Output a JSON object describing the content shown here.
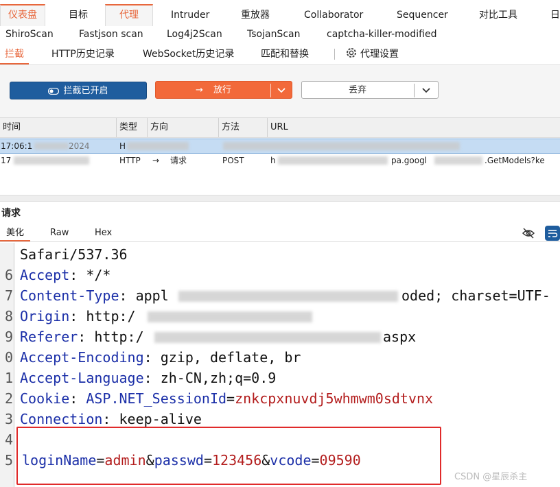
{
  "main_tabs": [
    "仪表盘",
    "目标",
    "代理",
    "Intruder",
    "重放器",
    "Collaborator",
    "Sequencer",
    "对比工具",
    "日"
  ],
  "ext_tabs": [
    "ShiroScan",
    "Fastjson scan",
    "Log4j2Scan",
    "TsojanScan",
    "captcha-killer-modified"
  ],
  "proxy_tabs": [
    "拦截",
    "HTTP历史记录",
    "WebSocket历史记录",
    "匹配和替换",
    "代理设置"
  ],
  "toolbar": {
    "intercept_label": "拦截已开启",
    "forward_label": "放行",
    "drop_label": "丢弃"
  },
  "table": {
    "columns": [
      "时间",
      "类型",
      "方向",
      "方法",
      "URL"
    ],
    "rows": [
      {
        "time": "17:06:1",
        "time_tail": "2024",
        "type": "H",
        "direction": "",
        "method": "",
        "url": ""
      },
      {
        "time": "17",
        "time_tail": "",
        "type": "HTTP",
        "direction": "请求",
        "method": "POST",
        "url_prefix": "h",
        "url": "pa.googl",
        "url_end": ".GetModels?ke"
      }
    ]
  },
  "request": {
    "title": "请求",
    "view_tabs": [
      "美化",
      "Raw",
      "Hex"
    ],
    "lines": [
      {
        "num": "",
        "value": "Safari/537.36"
      },
      {
        "num": "6",
        "key": "Accept",
        "value": "*/*"
      },
      {
        "num": "7",
        "key": "Content-Type",
        "value_a": "appl",
        "value_b": "oded; charset=UTF-"
      },
      {
        "num": "8",
        "key": "Origin",
        "value": "http:/"
      },
      {
        "num": "9",
        "key": "Referer",
        "value": "http:/",
        "value_end": "aspx"
      },
      {
        "num": "0",
        "key": "Accept-Encoding",
        "value": "gzip, deflate, br"
      },
      {
        "num": "1",
        "key": "Accept-Language",
        "value": "zh-CN,zh;q=0.9"
      },
      {
        "num": "2",
        "key": "Cookie",
        "cookie_name": "ASP.NET_SessionId",
        "cookie_value": "znkcpxnuvdj5whmwm0sdtvnx"
      },
      {
        "num": "3",
        "key": "Connection",
        "value": "keep-alive"
      },
      {
        "num": "4"
      },
      {
        "num": "5",
        "body": [
          {
            "k": "loginName",
            "v": "admin"
          },
          {
            "k": "passwd",
            "v": "123456"
          },
          {
            "k": "vcode",
            "v": "09590"
          }
        ]
      }
    ]
  },
  "watermark": "CSDN @星辰杀主"
}
